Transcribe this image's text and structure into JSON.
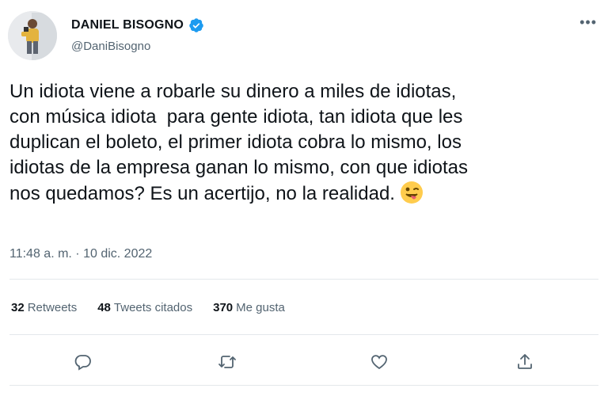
{
  "user": {
    "display_name": "DANIEL BISOGNO",
    "handle": "@DaniBisogno",
    "verified": true,
    "avatar_icon": "profile-photo"
  },
  "menu_icon": "more-icon",
  "tweet": {
    "text": "Un idiota viene a robarle su dinero a miles de idiotas,\ncon música idiota  para gente idiota, tan idiota que les\nduplican el boleto, el primer idiota cobra lo mismo, los\nidiotas de la empresa ganan lo mismo, con que idiotas\nnos quedamos? Es un acertijo, no la realidad.",
    "emoji": "winking-face-with-tongue",
    "timestamp": "11:48 a. m. · 10 dic. 2022"
  },
  "stats": {
    "retweets_count": "32",
    "retweets_label": "Retweets",
    "quotes_count": "48",
    "quotes_label": "Tweets citados",
    "likes_count": "370",
    "likes_label": "Me gusta"
  },
  "actions": [
    "reply-icon",
    "retweet-icon",
    "like-icon",
    "share-icon"
  ],
  "colors": {
    "verified": "#1d9bf0",
    "secondary_text": "#536471",
    "primary_text": "#0f1419",
    "divider": "#e4e8eb"
  }
}
